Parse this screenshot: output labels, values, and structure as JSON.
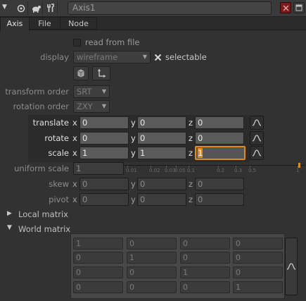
{
  "window": {
    "node_name": "Axis1"
  },
  "tabs": [
    "Axis",
    "File",
    "Node"
  ],
  "read_from_file": {
    "label": "read from file",
    "checked": false
  },
  "display": {
    "label": "display",
    "value": "wireframe",
    "selectable_label": "selectable",
    "selectable_checked": true
  },
  "transform_order": {
    "label": "transform order",
    "value": "SRT"
  },
  "rotation_order": {
    "label": "rotation order",
    "value": "ZXY"
  },
  "translate": {
    "label": "translate",
    "x": "0",
    "y": "0",
    "z": "0"
  },
  "rotate": {
    "label": "rotate",
    "x": "0",
    "y": "0",
    "z": "0"
  },
  "scale": {
    "label": "scale",
    "x": "1",
    "y": "1",
    "z": "1"
  },
  "uniform_scale": {
    "label": "uniform scale",
    "value": "1"
  },
  "slider_ticks": [
    "0.01",
    "0.02",
    "0.03",
    "0.05",
    "0.1",
    "0.2",
    "0.3",
    "0.5",
    "1"
  ],
  "skew": {
    "label": "skew",
    "x": "0",
    "y": "0",
    "z": "0"
  },
  "pivot": {
    "label": "pivot",
    "x": "0",
    "y": "0",
    "z": "0"
  },
  "local_matrix": {
    "label": "Local matrix",
    "expanded": false
  },
  "world_matrix": {
    "label": "World matrix",
    "expanded": true,
    "rows": [
      [
        "1",
        "0",
        "0",
        "0"
      ],
      [
        "0",
        "1",
        "0",
        "0"
      ],
      [
        "0",
        "0",
        "1",
        "0"
      ],
      [
        "0",
        "0",
        "0",
        "1"
      ]
    ]
  },
  "axis_letters": {
    "x": "x",
    "y": "y",
    "z": "z"
  },
  "colors": {
    "accent": "#e08a17",
    "background": "#323232"
  }
}
